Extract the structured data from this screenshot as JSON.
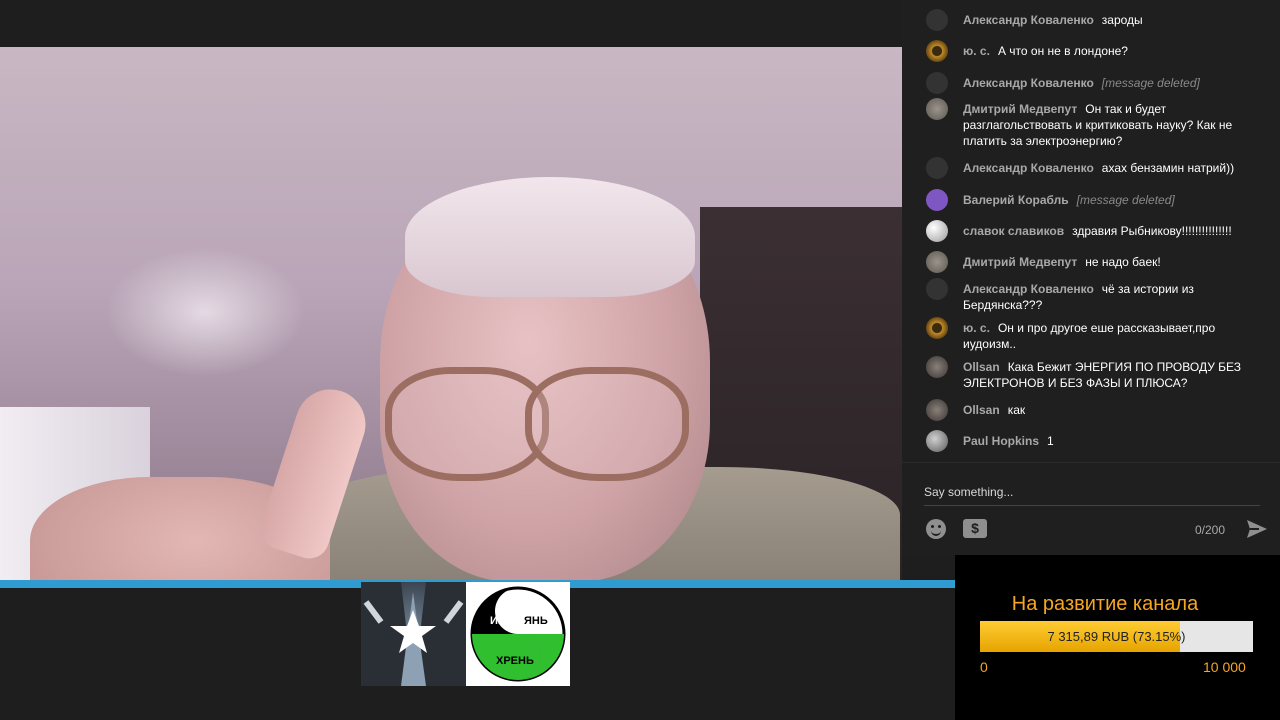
{
  "chat": {
    "messages": [
      {
        "author": "Александр Коваленко",
        "text": "зароды",
        "deleted": false,
        "avatar_color": "#333333"
      },
      {
        "author": "ю. с.",
        "text": "А что он не в лондоне?",
        "deleted": false,
        "avatar_color": "#c08a2a"
      },
      {
        "author": "Александр Коваленко",
        "text": "[message deleted]",
        "deleted": true,
        "avatar_color": "#333333"
      },
      {
        "author": "Дмитрий Медвепут",
        "text": "Он так и будет разглагольствовать и критиковать науку? Как не платить за электроэнергию?",
        "deleted": false,
        "avatar_color": "#7a7670"
      },
      {
        "author": "Александр Коваленко",
        "text": "ахах бензамин натрий))",
        "deleted": false,
        "avatar_color": "#333333"
      },
      {
        "author": "Валерий Корабль",
        "text": "[message deleted]",
        "deleted": true,
        "avatar_color": "#7e57c2"
      },
      {
        "author": "славок славиков",
        "text": "здравия Рыбникову!!!!!!!!!!!!!!!",
        "deleted": false,
        "avatar_color": "#e0e0e0"
      },
      {
        "author": "Дмитрий Медвепут",
        "text": "не надо баек!",
        "deleted": false,
        "avatar_color": "#7a7670"
      },
      {
        "author": "Александр Коваленко",
        "text": "чё за истории из Бердянска???",
        "deleted": false,
        "avatar_color": "#333333"
      },
      {
        "author": "ю. с.",
        "text": "Он и про другое еше рассказывает,про иудоизм..",
        "deleted": false,
        "avatar_color": "#c08a2a"
      },
      {
        "author": "Ollsan",
        "text": "Кака Бежит ЭНЕРГИЯ ПО ПРОВОДУ БЕЗ ЭЛЕКТРОНОВ И БЕЗ ФАЗЫ И ПЛЮСА?",
        "deleted": false,
        "avatar_color": "#5a5552"
      },
      {
        "author": "Ollsan",
        "text": "как",
        "deleted": false,
        "avatar_color": "#5a5552"
      },
      {
        "author": "Paul Hopkins",
        "text": "1",
        "deleted": false,
        "avatar_color": "#9a9a9a"
      }
    ],
    "input_placeholder": "Say something...",
    "char_counter": "0/200",
    "icons": {
      "emoji": "emoji-icon",
      "super_chat": "dollar-icon",
      "send": "send-icon"
    }
  },
  "donation": {
    "title": "На развитие канала",
    "progress_text": "7 315,89 RUB (73.15%)",
    "progress_fraction": 0.7315,
    "min_label": "0",
    "max_label": "10 000",
    "accent_color": "#f5a623"
  },
  "logos": {
    "yin_yang": {
      "left": "ИНЬ",
      "right": "ЯНЬ",
      "bottom": "ХРЕНЬ"
    }
  }
}
